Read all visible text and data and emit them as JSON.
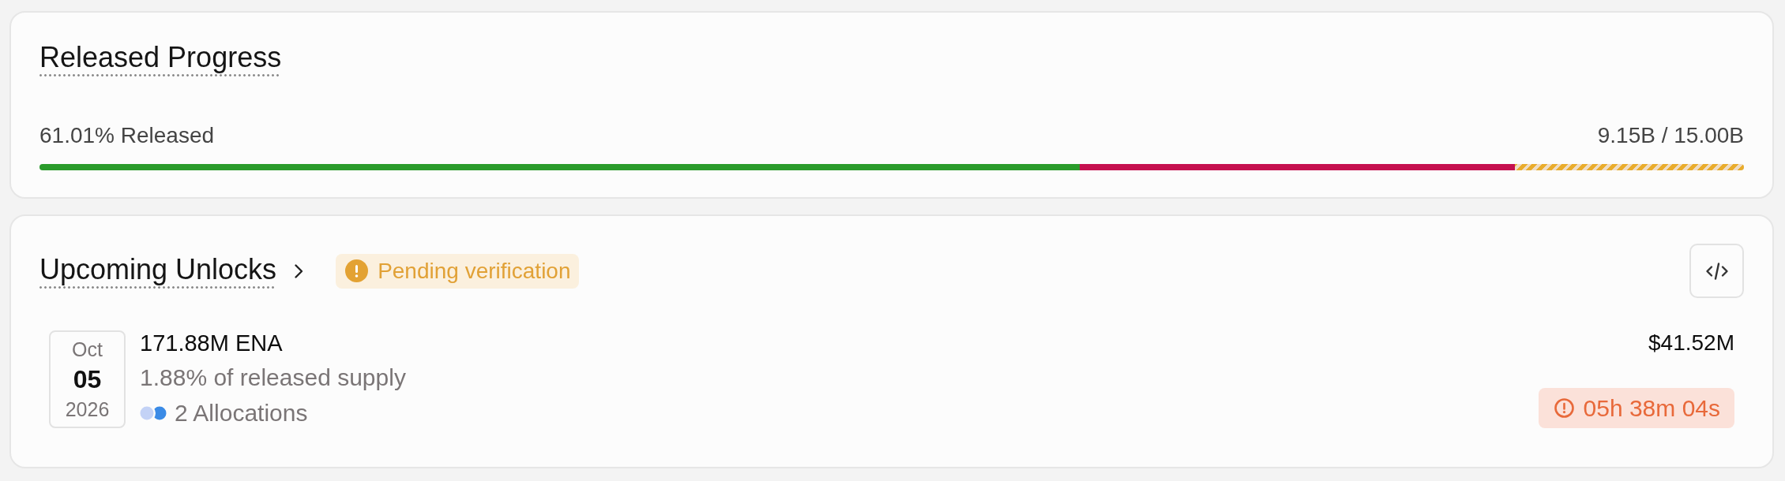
{
  "released_progress": {
    "title": "Released Progress",
    "label": "61.01% Released",
    "amount": "9.15B / 15.00B",
    "bar": {
      "level": 0.6101,
      "remainder": {
        "level": 0.655
      }
    }
  },
  "upcoming_unlocks": {
    "title": "Upcoming Unlocks",
    "status_badge": "Pending verification",
    "events": [
      {
        "month": "Oct",
        "day": "05",
        "year": "2026",
        "amount": "171.88M ENA",
        "share": "1.88% of released supply",
        "allocations": "2 Allocations",
        "value": "$41.52M",
        "countdown": "05h 38m 04s"
      }
    ]
  }
}
